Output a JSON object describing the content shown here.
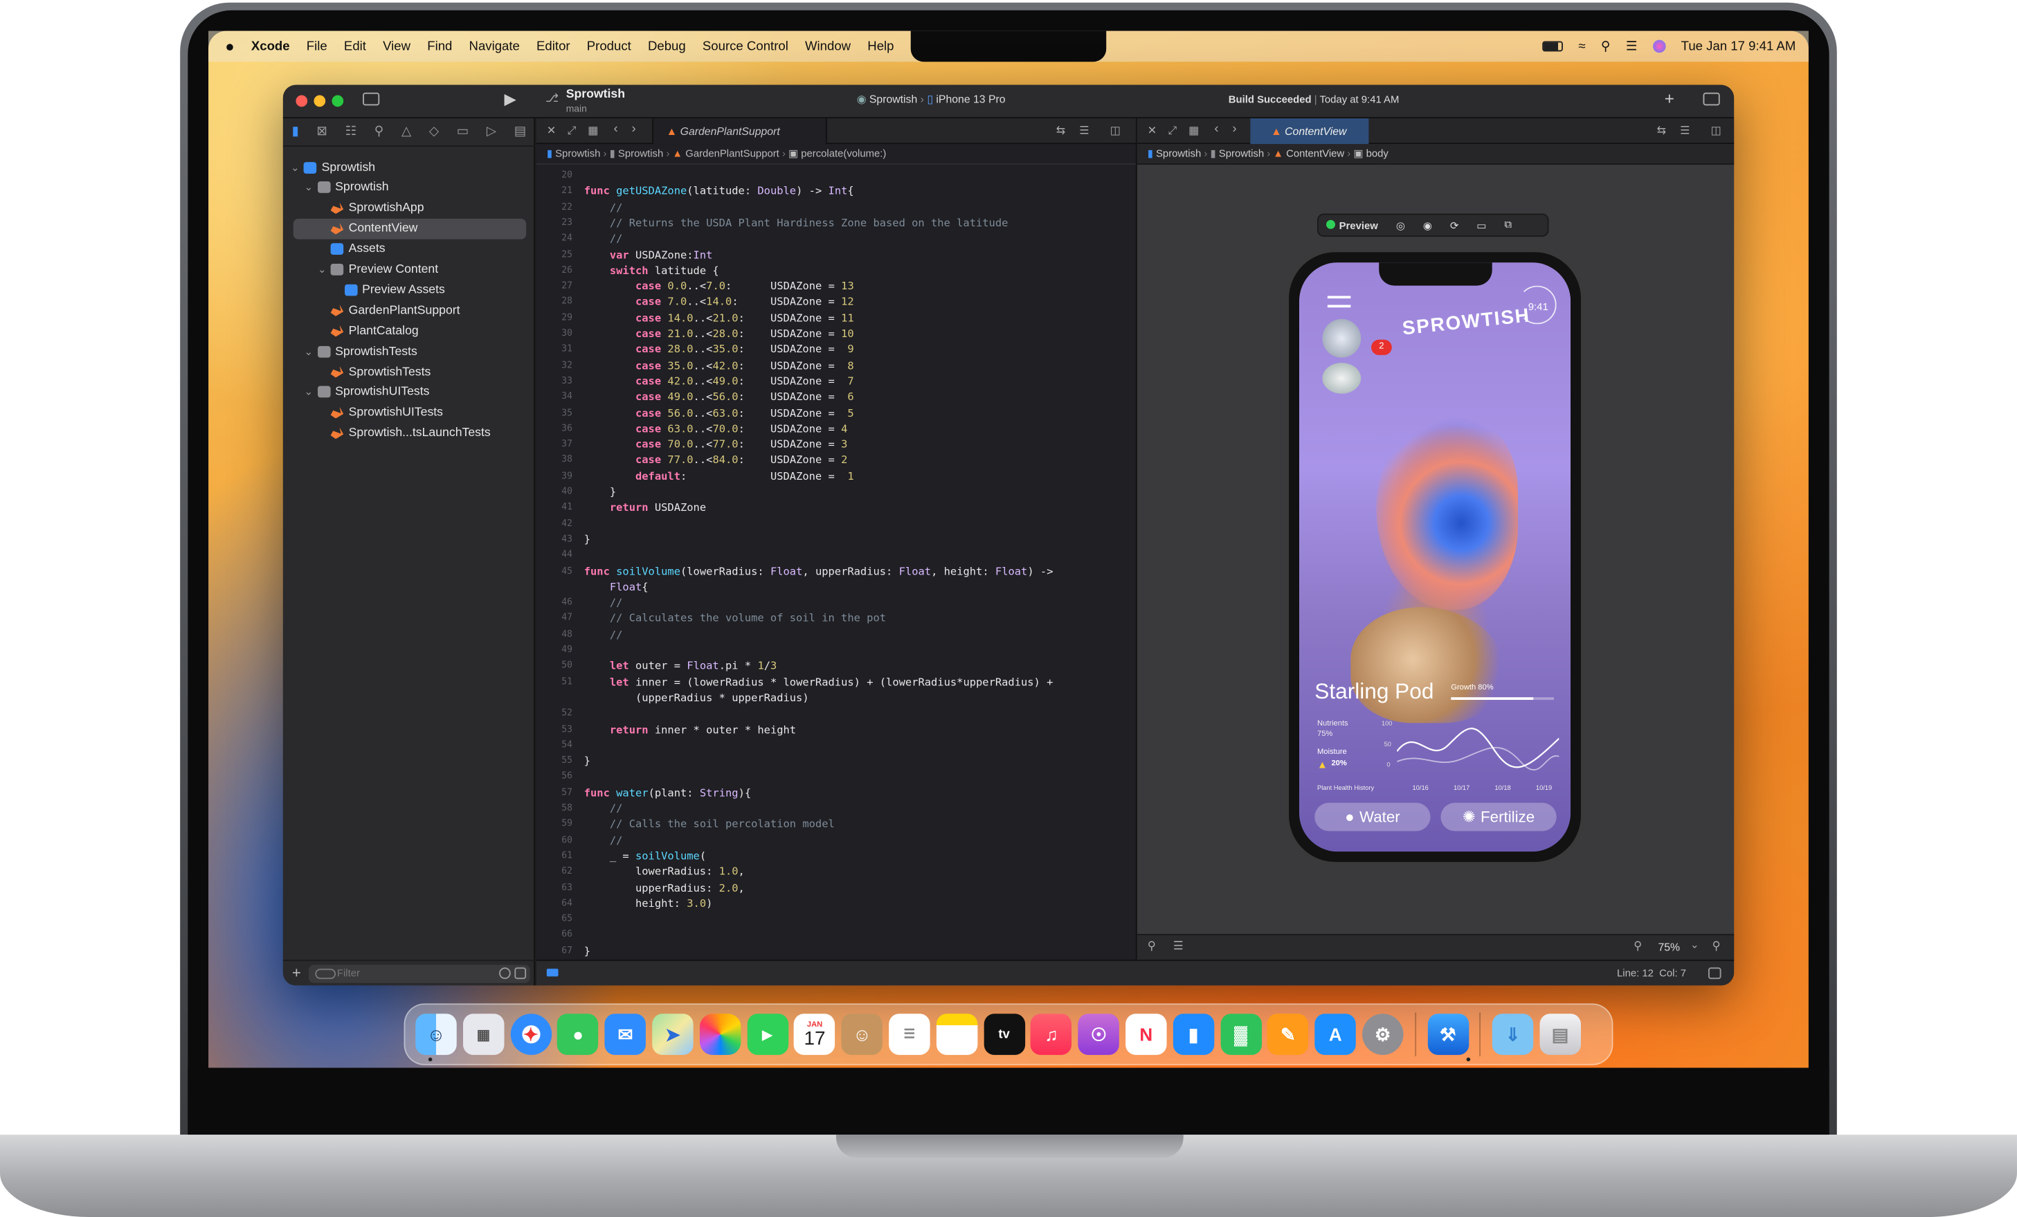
{
  "menubar": {
    "apple_icon": "apple-logo",
    "app": "Xcode",
    "items": [
      "File",
      "Edit",
      "View",
      "Find",
      "Navigate",
      "Editor",
      "Product",
      "Debug",
      "Source Control",
      "Window",
      "Help"
    ],
    "clock": "Tue Jan 17  9:41 AM"
  },
  "toolbar": {
    "project": "Sprowtish",
    "branch": "main",
    "scheme": "Sprowtish",
    "device": "iPhone 13 Pro",
    "status": "Build Succeeded",
    "status_time": "Today at 9:41 AM"
  },
  "navigator": {
    "items": [
      {
        "label": "Sprowtish",
        "icon": "project-icon",
        "depth": 0,
        "expanded": true
      },
      {
        "label": "Sprowtish",
        "icon": "folder-icon",
        "depth": 1,
        "expanded": true
      },
      {
        "label": "SprowtishApp",
        "icon": "swift-icon",
        "depth": 2
      },
      {
        "label": "ContentView",
        "icon": "swift-icon",
        "depth": 2,
        "selected": true
      },
      {
        "label": "Assets",
        "icon": "asset-catalog-icon",
        "depth": 2
      },
      {
        "label": "Preview Content",
        "icon": "folder-icon",
        "depth": 2,
        "expanded": true
      },
      {
        "label": "Preview Assets",
        "icon": "asset-catalog-icon",
        "depth": 3
      },
      {
        "label": "GardenPlantSupport",
        "icon": "swift-icon",
        "depth": 2
      },
      {
        "label": "PlantCatalog",
        "icon": "swift-icon",
        "depth": 2
      },
      {
        "label": "SprowtishTests",
        "icon": "folder-icon",
        "depth": 1,
        "expanded": true
      },
      {
        "label": "SprowtishTests",
        "icon": "swift-icon",
        "depth": 2
      },
      {
        "label": "SprowtishUITests",
        "icon": "folder-icon",
        "depth": 1,
        "expanded": true
      },
      {
        "label": "SprowtishUITests",
        "icon": "swift-icon",
        "depth": 2
      },
      {
        "label": "Sprowtish...tsLaunchTests",
        "icon": "swift-icon",
        "depth": 2
      }
    ],
    "filter_placeholder": "Filter"
  },
  "editor": {
    "tab": "GardenPlantSupport",
    "jumpbar": [
      "Sprowtish",
      "Sprowtish",
      "GardenPlantSupport",
      "percolate(volume:)"
    ],
    "start_line": 20,
    "lines": [
      "",
      "func getUSDAZone(latitude: Double) -> Int{",
      "    //",
      "    // Returns the USDA Plant Hardiness Zone based on the latitude",
      "    //",
      "    var USDAZone:Int",
      "    switch latitude {",
      "        case 0.0..<7.0:      USDAZone = 13",
      "        case 7.0..<14.0:     USDAZone = 12",
      "        case 14.0..<21.0:    USDAZone = 11",
      "        case 21.0..<28.0:    USDAZone = 10",
      "        case 28.0..<35.0:    USDAZone =  9",
      "        case 35.0..<42.0:    USDAZone =  8",
      "        case 42.0..<49.0:    USDAZone =  7",
      "        case 49.0..<56.0:    USDAZone =  6",
      "        case 56.0..<63.0:    USDAZone =  5",
      "        case 63.0..<70.0:    USDAZone = 4",
      "        case 70.0..<77.0:    USDAZone = 3",
      "        case 77.0..<84.0:    USDAZone = 2",
      "        default:             USDAZone =  1",
      "    }",
      "    return USDAZone",
      "",
      "}",
      "",
      "func soilVolume(lowerRadius: Float, upperRadius: Float, height: Float) ->",
      "    Float{",
      "    //",
      "    // Calculates the volume of soil in the pot",
      "    //",
      "",
      "    let outer = Float.pi * 1/3",
      "    let inner = (lowerRadius * lowerRadius) + (lowerRadius*upperRadius) +",
      "        (upperRadius * upperRadius)",
      "",
      "    return inner * outer * height",
      "",
      "}",
      "",
      "func water(plant: String){",
      "    //",
      "    // Calls the soil percolation model",
      "    //",
      "    _ = soilVolume(",
      "        lowerRadius: 1.0,",
      "        upperRadius: 2.0,",
      "        height: 3.0)",
      "",
      "",
      "}"
    ],
    "line_numbers": [
      "20",
      "21",
      "22",
      "23",
      "24",
      "25",
      "26",
      "27",
      "28",
      "29",
      "30",
      "31",
      "32",
      "33",
      "34",
      "35",
      "36",
      "37",
      "38",
      "39",
      "40",
      "41",
      "42",
      "43",
      "44",
      "45",
      "",
      "46",
      "47",
      "48",
      "49",
      "50",
      "51",
      "",
      "52",
      "53",
      "54",
      "55",
      "56",
      "57",
      "58",
      "59",
      "60",
      "61",
      "62",
      "63",
      "64",
      "65",
      "66",
      "67"
    ]
  },
  "canvas": {
    "tab": "ContentView",
    "jumpbar": [
      "Sprowtish",
      "Sprowtish",
      "ContentView",
      "body"
    ],
    "preview_label": "Preview",
    "zoom": "75%"
  },
  "status": {
    "line_col": "Line: 12  Col: 7"
  },
  "app_preview": {
    "time": "9:41",
    "logo": "SPROWTISH",
    "badge": "2",
    "plant_name": "Starling Pod",
    "growth": "Growth 80%",
    "nutrients_label": "Nutrients",
    "nutrients_value": "75%",
    "moisture_label": "Moisture",
    "moisture_value": "20%",
    "y_ticks": [
      "100",
      "50",
      "0"
    ],
    "x_ticks": [
      "10/16",
      "10/17",
      "10/18",
      "10/19"
    ],
    "history_label": "Plant Health History",
    "water_button": "Water",
    "fertilize_button": "Fertilize"
  },
  "dock": {
    "apps": [
      "finder",
      "launchpad",
      "safari",
      "messages",
      "mail",
      "maps",
      "photos",
      "facetime",
      "calendar",
      "contacts",
      "reminders",
      "notes",
      "tv",
      "music",
      "podcasts",
      "news",
      "keynote",
      "numbers",
      "pages",
      "app-store",
      "system-settings",
      "xcode",
      "downloads",
      "trash"
    ],
    "calendar_month": "JAN",
    "calendar_day": "17",
    "tv_label": "tv"
  }
}
